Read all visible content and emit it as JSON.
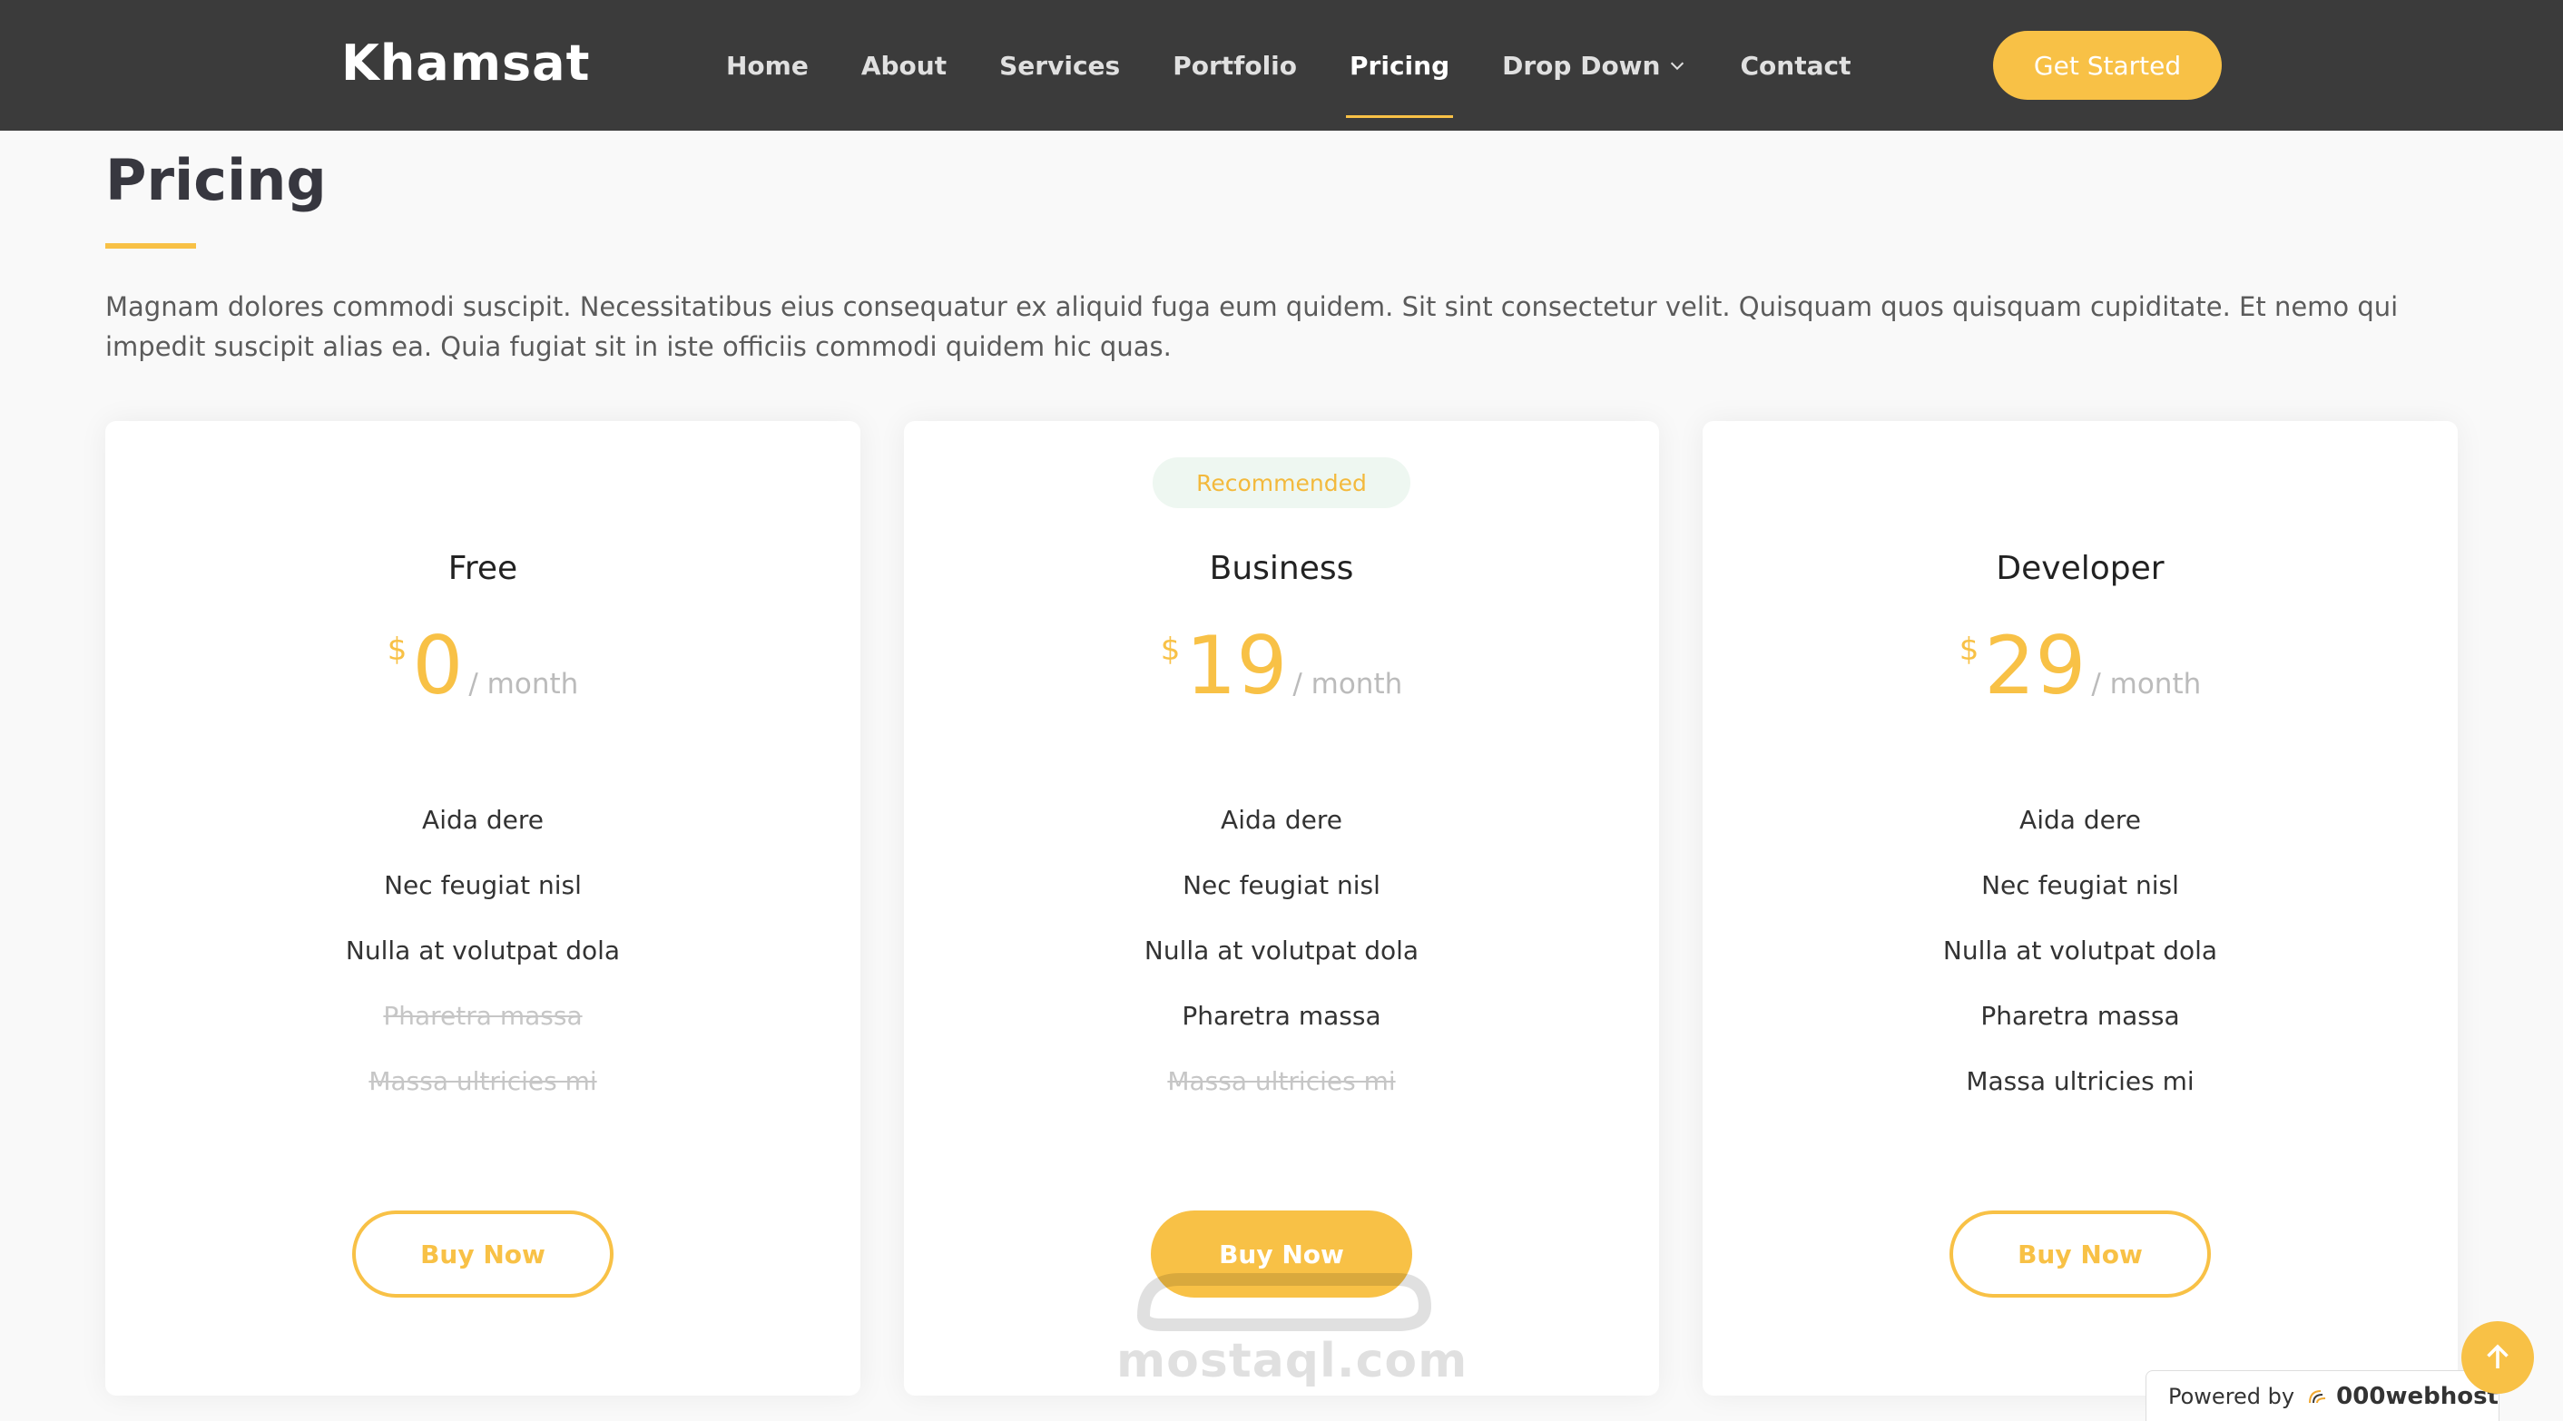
{
  "header": {
    "logo": "Khamsat",
    "nav": [
      {
        "label": "Home"
      },
      {
        "label": "About"
      },
      {
        "label": "Services"
      },
      {
        "label": "Portfolio"
      },
      {
        "label": "Pricing",
        "active": true
      },
      {
        "label": "Drop Down",
        "has_dropdown": true
      },
      {
        "label": "Contact"
      }
    ],
    "cta_label": "Get Started"
  },
  "section": {
    "title": "Pricing",
    "description": "Magnam dolores commodi suscipit. Necessitatibus eius consequatur ex aliquid fuga eum quidem. Sit sint consectetur velit. Quisquam quos quisquam cupiditate. Et nemo qui impedit suscipit alias ea. Quia fugiat sit in iste officiis commodi quidem hic quas."
  },
  "plans": [
    {
      "name": "Free",
      "currency": "$",
      "price": "0",
      "period": "/ month",
      "button": "Buy Now",
      "features": [
        {
          "text": "Aida dere",
          "available": true
        },
        {
          "text": "Nec feugiat nisl",
          "available": true
        },
        {
          "text": "Nulla at volutpat dola",
          "available": true
        },
        {
          "text": "Pharetra massa",
          "available": false
        },
        {
          "text": "Massa ultricies mi",
          "available": false
        }
      ]
    },
    {
      "name": "Business",
      "badge": "Recommended",
      "currency": "$",
      "price": "19",
      "period": "/ month",
      "button": "Buy Now",
      "features": [
        {
          "text": "Aida dere",
          "available": true
        },
        {
          "text": "Nec feugiat nisl",
          "available": true
        },
        {
          "text": "Nulla at volutpat dola",
          "available": true
        },
        {
          "text": "Pharetra massa",
          "available": true
        },
        {
          "text": "Massa ultricies mi",
          "available": false
        }
      ]
    },
    {
      "name": "Developer",
      "currency": "$",
      "price": "29",
      "period": "/ month",
      "button": "Buy Now",
      "features": [
        {
          "text": "Aida dere",
          "available": true
        },
        {
          "text": "Nec feugiat nisl",
          "available": true
        },
        {
          "text": "Nulla at volutpat dola",
          "available": true
        },
        {
          "text": "Pharetra massa",
          "available": true
        },
        {
          "text": "Massa ultricies mi",
          "available": true
        }
      ]
    }
  ],
  "watermark": {
    "text": "mostaql.com"
  },
  "footer_badge": {
    "powered_label": "Powered by",
    "host_name": "000webhost"
  },
  "icons": {
    "dropdown": "chevron-down-icon",
    "back_to_top": "arrow-up-icon",
    "host_logo": "webhost-logo-icon"
  },
  "colors": {
    "accent": "#f8c146",
    "header_bg": "#3b3b3b",
    "page_bg": "#f9f9f9",
    "badge_bg": "#eef7f1"
  }
}
